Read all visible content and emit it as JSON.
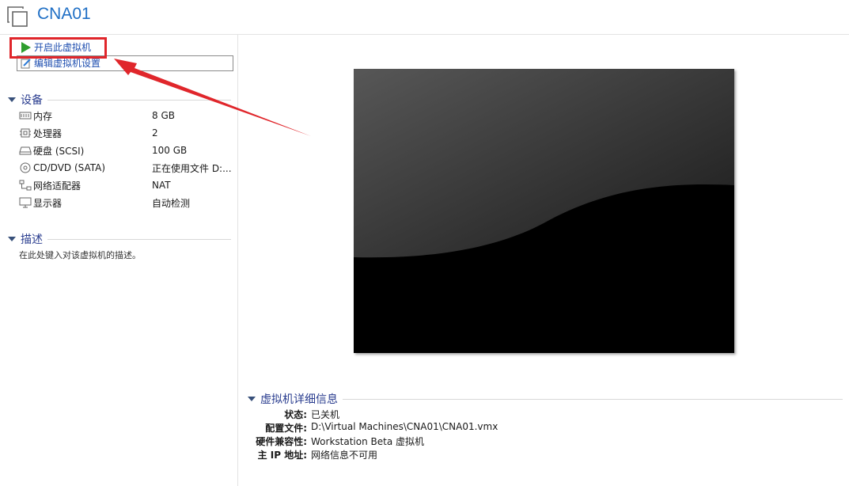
{
  "header": {
    "title": "CNA01"
  },
  "actions": {
    "start_label": "开启此虚拟机",
    "edit_label": "编辑虚拟机设置"
  },
  "devices": {
    "heading": "设备",
    "items": [
      {
        "icon": "memory-icon",
        "name": "内存",
        "value": "8 GB"
      },
      {
        "icon": "cpu-icon",
        "name": "处理器",
        "value": "2"
      },
      {
        "icon": "disk-icon",
        "name": "硬盘 (SCSI)",
        "value": "100 GB"
      },
      {
        "icon": "cd-icon",
        "name": "CD/DVD (SATA)",
        "value": "正在使用文件 D:..."
      },
      {
        "icon": "network-icon",
        "name": "网络适配器",
        "value": "NAT"
      },
      {
        "icon": "monitor-icon",
        "name": "显示器",
        "value": "自动检测"
      }
    ]
  },
  "description": {
    "heading": "描述",
    "placeholder": "在此处键入对该虚拟机的描述。"
  },
  "details": {
    "heading": "虚拟机详细信息",
    "rows": [
      {
        "key": "状态:",
        "value": "已关机"
      },
      {
        "key": "配置文件:",
        "value": "D:\\Virtual Machines\\CNA01\\CNA01.vmx"
      },
      {
        "key": "硬件兼容性:",
        "value": "Workstation Beta 虚拟机"
      },
      {
        "key": "主 IP 地址:",
        "value": "网络信息不可用"
      }
    ]
  },
  "colors": {
    "title": "#1f6fc5",
    "link": "#1f4fb0",
    "highlight": "#e0262b",
    "section": "#2a3d8f",
    "play": "#2e9e2e"
  }
}
